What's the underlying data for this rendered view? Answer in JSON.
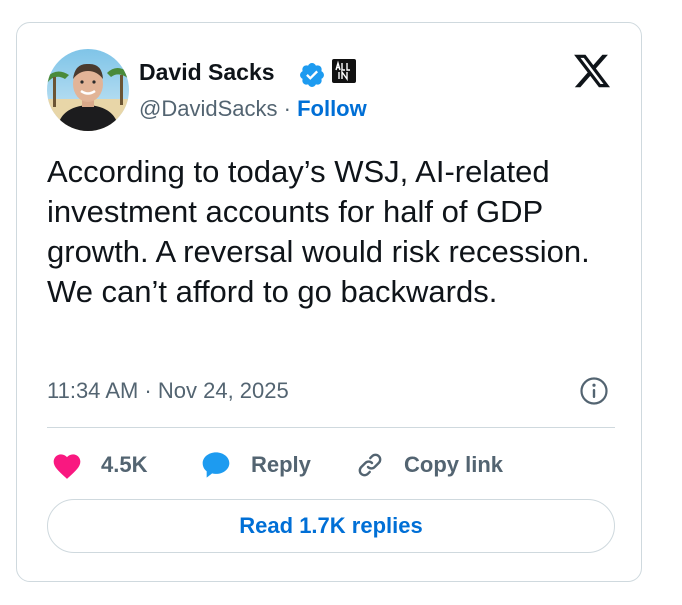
{
  "author": {
    "display_name": "David Sacks",
    "handle": "@DavidSacks",
    "separator": "·",
    "follow_label": "Follow",
    "affiliate_badge_text": "ALL IN",
    "verified_badge_color": "#1d9bf0"
  },
  "tweet": {
    "text": "According to today’s WSJ, AI-related investment accounts for half of GDP growth. A reversal would risk recession. We can’t afford to go backwards.",
    "timestamp": "11:34 AM · Nov 24, 2025"
  },
  "actions": {
    "like_count": "4.5K",
    "reply_label": "Reply",
    "copy_link_label": "Copy link",
    "read_replies_label": "Read 1.7K replies"
  },
  "icons": {
    "brand": "x-logo-icon",
    "info": "info-icon",
    "like": "heart-icon",
    "reply": "speech-bubble-icon",
    "copy": "link-icon"
  },
  "colors": {
    "link_blue": "#006fd6",
    "heart_pink": "#f91880",
    "text_primary": "#0f1419",
    "text_secondary": "#536471",
    "border": "#cfd9de"
  }
}
